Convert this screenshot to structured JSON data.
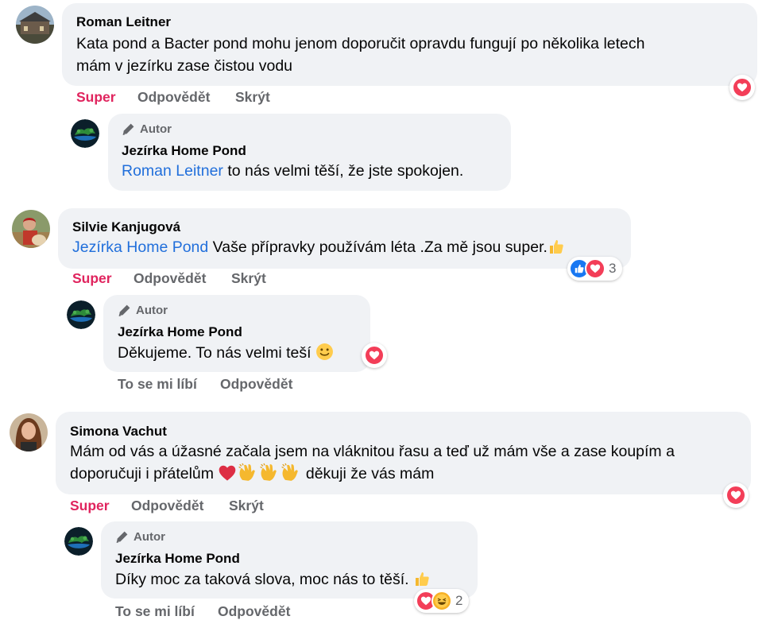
{
  "comments": [
    {
      "author": "Roman Leitner",
      "text_line1": "Kata pond a Bacter pond mohu jenom doporučit opravdu fungují po několika letech",
      "text_line2": "mám v jezírku zase čistou vodu",
      "actions": {
        "like": "Super",
        "reply": "Odpovědět",
        "hide": "Skrýt"
      },
      "reaction_icon": "heart-icon",
      "reply": {
        "badge": "Autor",
        "author": "Jezírka Home Pond",
        "mention": "Roman Leitner",
        "text": " to nás velmi těší, že jste spokojen."
      }
    },
    {
      "author": "Silvie Kanjugová",
      "mention": "Jezírka Home Pond",
      "text": " Vaše přípravky používám léta .Za mě jsou super.",
      "emoji": "thumbs-up-emoji",
      "actions": {
        "like": "Super",
        "reply": "Odpovědět",
        "hide": "Skrýt"
      },
      "reactions": {
        "icons": [
          "like-icon",
          "heart-icon"
        ],
        "count": "3"
      },
      "reply": {
        "badge": "Autor",
        "author": "Jezírka Home Pond",
        "text": "Děkujeme. To nás velmi teší ",
        "emoji": "smile-emoji",
        "reaction_icon": "heart-icon",
        "actions": {
          "like": "To se mi líbí",
          "reply": "Odpovědět"
        }
      }
    },
    {
      "author": "Simona Vachut",
      "text_line1": "Mám od vás a úžasné začala jsem na vláknitou řasu a teď už mám vše a zase koupím a",
      "text_line2a": "doporučuji i přátelům ",
      "text_line2b": " děkuji že vás mám",
      "emojis": [
        "red-heart-emoji",
        "clapping-hands-emoji",
        "clapping-hands-emoji",
        "clapping-hands-emoji"
      ],
      "actions": {
        "like": "Super",
        "reply": "Odpovědět",
        "hide": "Skrýt"
      },
      "reaction_icon": "heart-icon",
      "reply": {
        "badge": "Autor",
        "author": "Jezírka Home Pond",
        "text": "Díky moc za taková slova, moc nás to těší. ",
        "emoji": "thumbs-up-emoji",
        "reactions": {
          "icons": [
            "heart-icon",
            "haha-icon"
          ],
          "count": "2"
        },
        "actions": {
          "like": "To se mi líbí",
          "reply": "Odpovědět"
        }
      }
    }
  ],
  "colors": {
    "bubble": "#f0f2f5",
    "mention": "#216fdb",
    "active": "#e0245e",
    "muted": "#65676b",
    "heart": "#f33e58",
    "like": "#1877f2"
  }
}
